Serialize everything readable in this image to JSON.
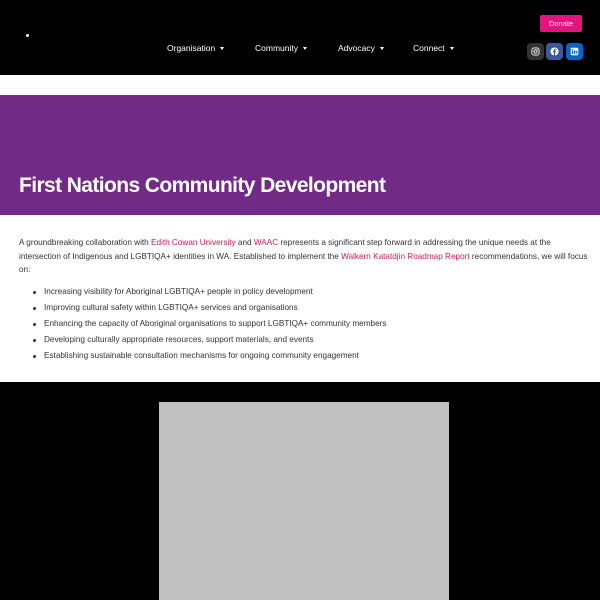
{
  "header": {
    "nav": [
      {
        "label": "Organisation"
      },
      {
        "label": "Community"
      },
      {
        "label": "Advocacy"
      },
      {
        "label": "Connect"
      }
    ],
    "donate_label": "Donate",
    "social_icons": [
      "instagram-icon",
      "facebook-icon",
      "linkedin-icon"
    ]
  },
  "hero": {
    "title": "First Nations Community Development"
  },
  "content": {
    "intro_part1": "A groundbreaking collaboration with ",
    "link_ecu": "Edith Cowan University",
    "intro_part2": " and ",
    "link_waac": "WAAC",
    "intro_part3": " represents a significant step forward in addressing the unique needs at the intersection of Indigenous and LGBTIQA+ identities in WA. Established to implement the ",
    "link_roadmap": "Walkern Katatdjin Roadmap Report",
    "intro_part4": " recommendations, we will focus on:",
    "focus_items": [
      "Increasing visibility for Aboriginal LGBTIQA+ people in policy development",
      "Improving cultural safety within LGBTIQA+ services and organisations",
      "Enhancing the capacity of Aboriginal organisations to support LGBTIQA+ community members",
      "Developing culturally appropriate resources, support materials, and events",
      "Establishing sustainable consultation mechanisms for ongoing community engagement"
    ]
  },
  "colors": {
    "hero_bg": "#722a87",
    "donate_bg": "#e3147e",
    "link": "#c8205f",
    "placeholder": "#c1c1c1"
  }
}
